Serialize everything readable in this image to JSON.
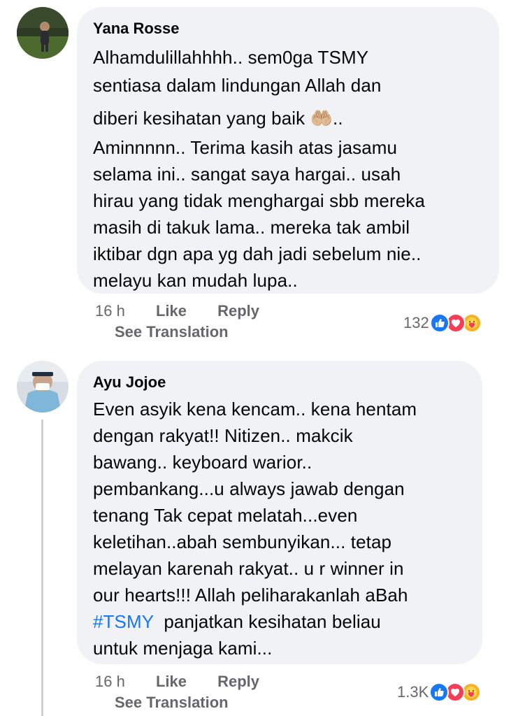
{
  "comments": [
    {
      "author": "Yana Rosse",
      "lines": [
        "Alhamdulillahhhh.. sem0ga TSMY",
        "sentiasa dalam lindungan Allah dan",
        "diberi kesihatan yang baik 🤲🏼..",
        "Aminnnnn.. Terima kasih atas jasamu",
        "selama ini.. sangat saya hargai.. usah",
        "hirau yang tidak menghargai sbb mereka",
        "masih di takuk lama.. mereka tak ambil",
        "iktibar dgn apa yg dah jadi sebelum nie..",
        "melayu kan mudah lupa.."
      ],
      "time": "16 h",
      "like_label": "Like",
      "reply_label": "Reply",
      "translate_label": "See Translation",
      "reaction_count": "132",
      "reaction_icons": [
        "like-icon",
        "love-icon",
        "care-icon"
      ]
    },
    {
      "author": "Ayu Jojoe",
      "lines": [
        "Even asyik kena kencam.. kena hentam",
        "dengan rakyat!! Nitizen.. makcik",
        "bawang.. keyboard warior..",
        "pembankang...u always jawab dengan",
        "tenang Tak cepat melatah...even",
        "keletihan..abah sembunyikan... tetap",
        "melayan karenah rakyat.. u r winner in",
        "our hearts!!! Allah peliharakanlah aBah"
      ],
      "hashtag": "#TSMY",
      "hashtag_rest": "  panjatkan kesihatan beliau",
      "last_line": "untuk menjaga kami...",
      "time": "16 h",
      "like_label": "Like",
      "reply_label": "Reply",
      "translate_label": "See Translation",
      "reaction_count": "1.3K",
      "reaction_icons": [
        "like-icon",
        "love-icon",
        "care-icon"
      ]
    }
  ],
  "colors": {
    "bubble": "#f0f2f5",
    "meta_text": "#65676b",
    "hashtag": "#1877f2",
    "like": "#1877f2",
    "love": "#f33e58",
    "care": "#f7b125"
  }
}
